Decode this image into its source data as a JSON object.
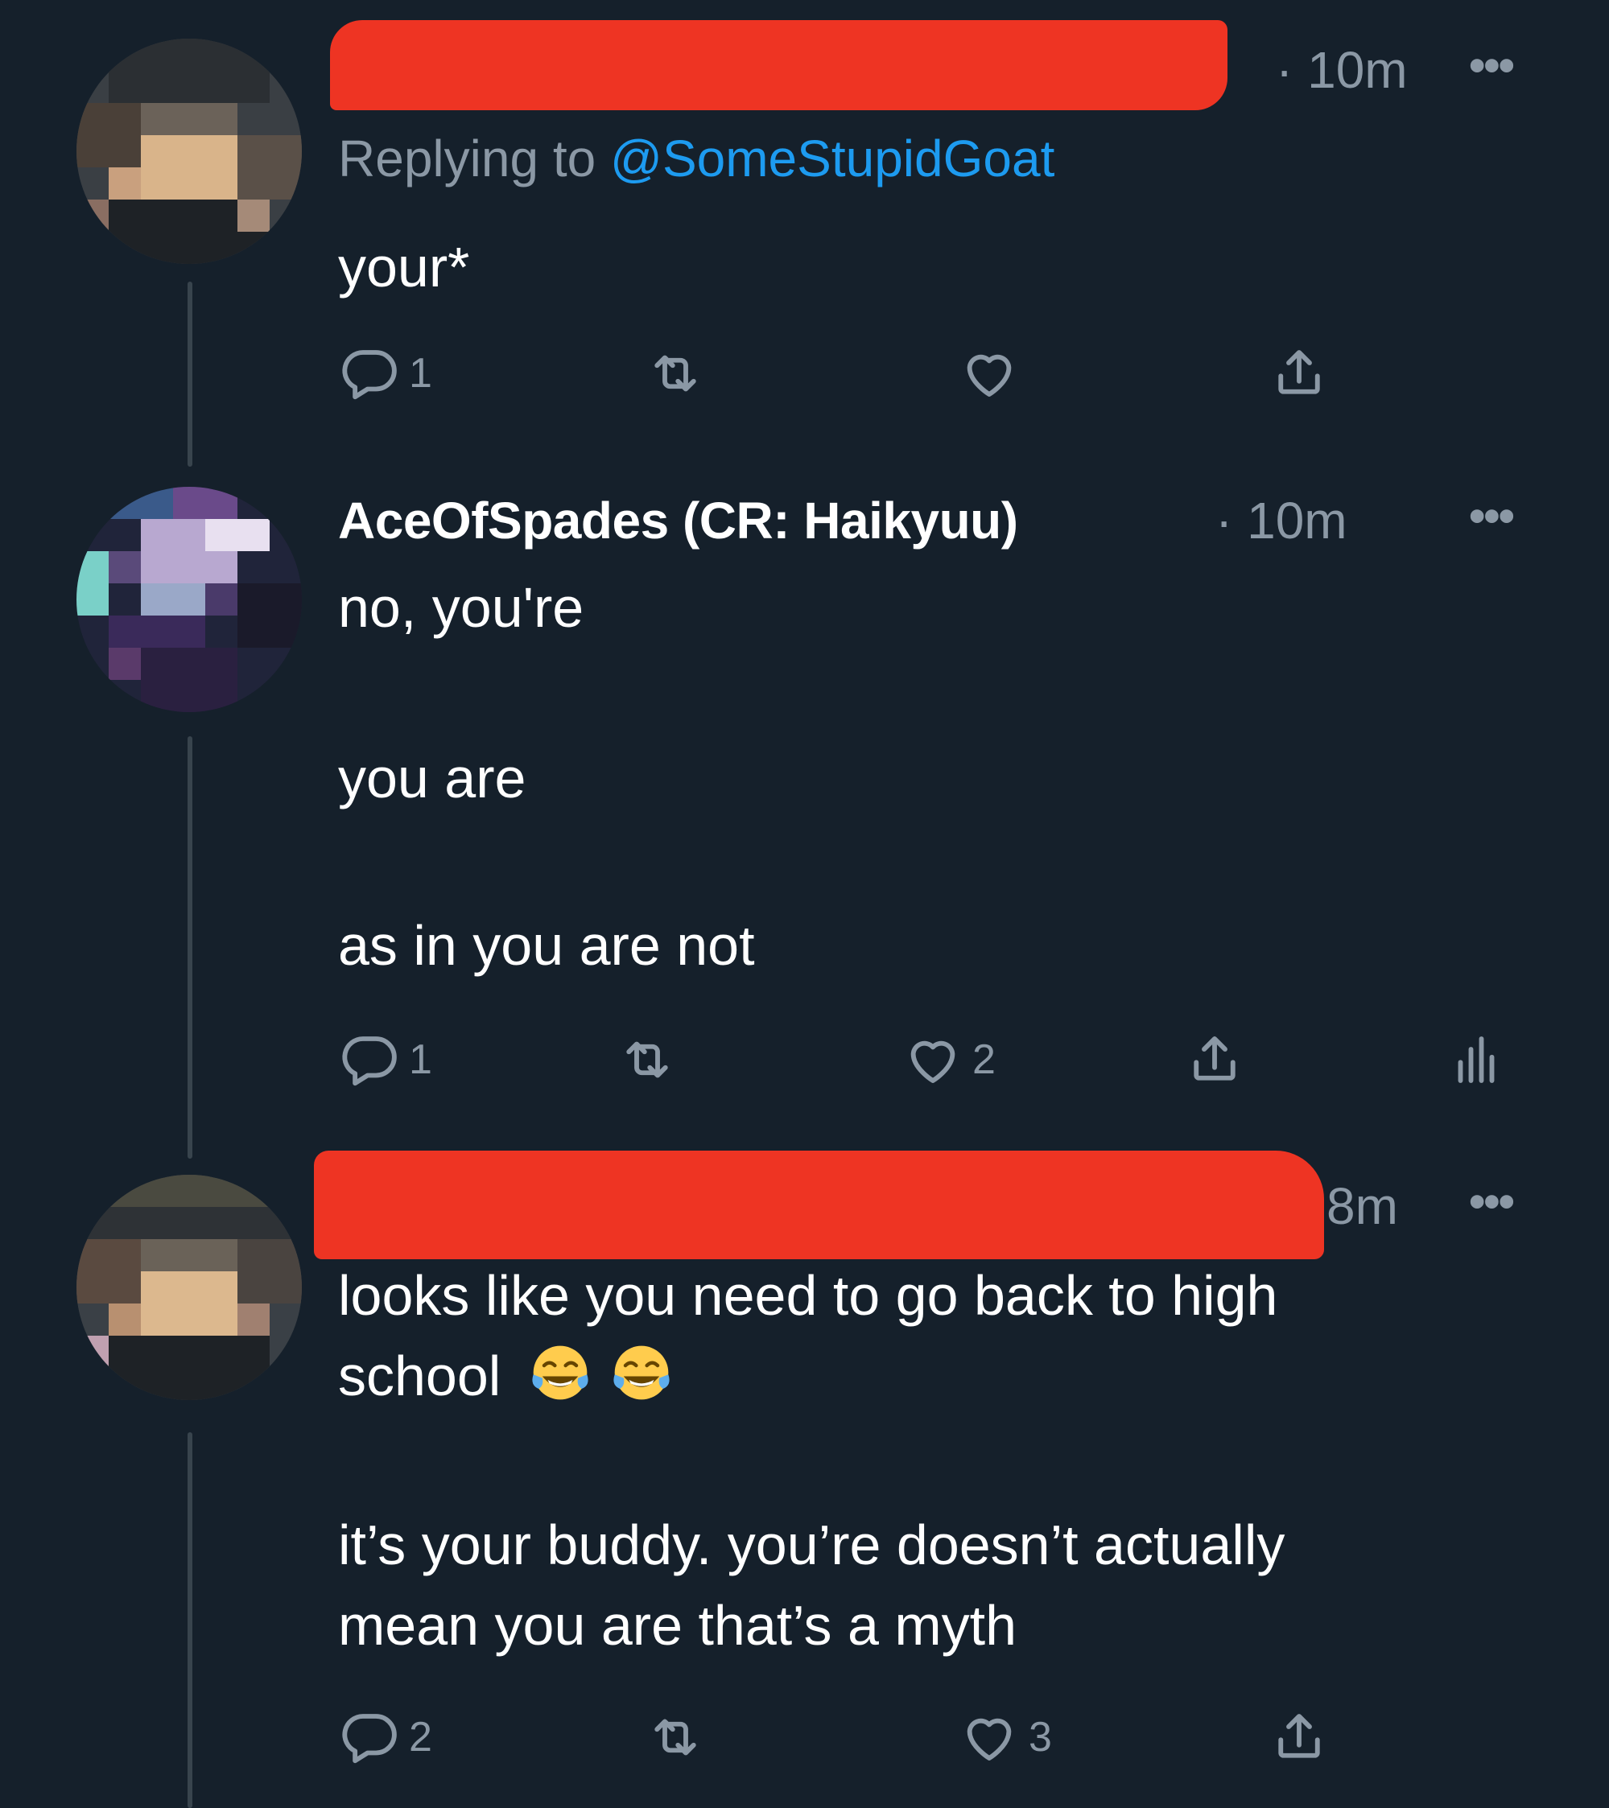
{
  "tweets": [
    {
      "time_label": "· 10m",
      "replying_prefix": "Replying to",
      "replying_handle": "@SomeStupidGoat",
      "text_lines": [
        "your*"
      ],
      "actions": {
        "reply_count": "1",
        "retweet_count": "",
        "like_count": "",
        "share": ""
      }
    },
    {
      "display_name": "AceOfSpades (CR: Haikyuu)",
      "time_label": "· 10m",
      "text_lines": [
        "no, you're",
        "you are",
        "as in you are not"
      ],
      "actions": {
        "reply_count": "1",
        "retweet_count": "",
        "like_count": "2",
        "share": ""
      }
    },
    {
      "time_label": "8m",
      "text_lines": [
        "looks like you need to go back to high",
        "school",
        "it’s your buddy. you’re doesn’t actually",
        "mean you are that’s a myth"
      ],
      "emoji": [
        "face-with-tears-of-joy",
        "face-with-tears-of-joy"
      ],
      "actions": {
        "reply_count": "2",
        "retweet_count": "",
        "like_count": "3",
        "share": ""
      }
    }
  ],
  "icons": {
    "reply": "speech-bubble-icon",
    "retweet": "retweet-icon",
    "like": "heart-icon",
    "share": "share-icon",
    "analytics": "analytics-bars-icon",
    "more": "more-dots-icon"
  },
  "colors": {
    "background": "#15202b",
    "secondary_text": "#8b98a5",
    "link": "#1d9bf0",
    "redaction": "#ee3423",
    "thread_line": "#38444d"
  }
}
